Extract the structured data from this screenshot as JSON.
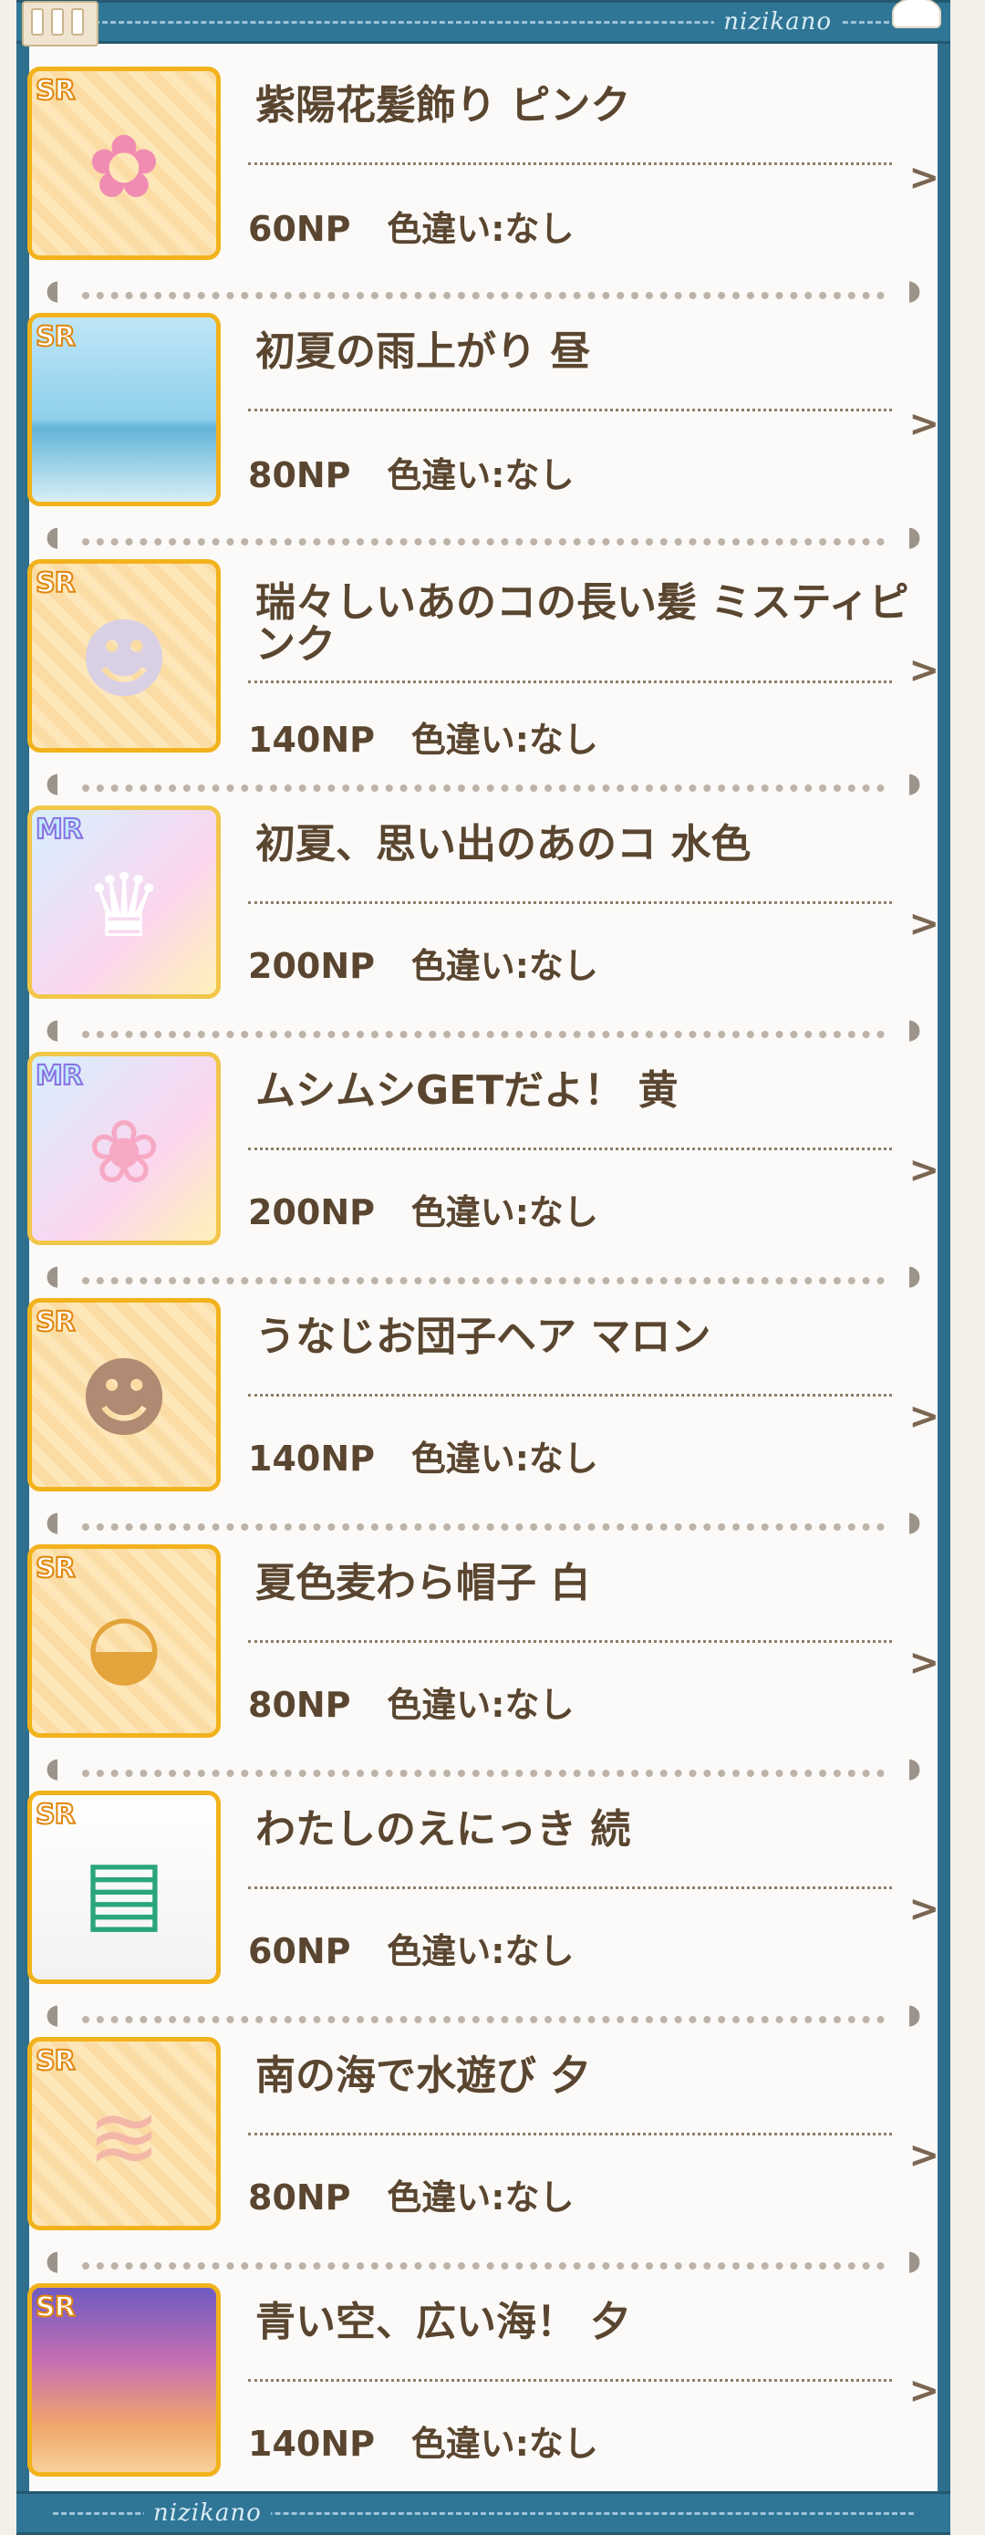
{
  "header": {
    "brand": "nizikano"
  },
  "footer": {
    "brand": "nizikano"
  },
  "items": [
    {
      "rarity": "SR",
      "name": "紫陽花髪飾り ピンク",
      "price": "60NP",
      "variant": "色違い:なし",
      "icon": "hydrangea-hair-ornament-icon"
    },
    {
      "rarity": "SR",
      "name": "初夏の雨上がり 昼",
      "price": "80NP",
      "variant": "色違い:なし",
      "icon": "sky-background-icon"
    },
    {
      "rarity": "SR",
      "name": "瑞々しいあのコの長い髪 ミスティピンク",
      "price": "140NP",
      "variant": "色違い:なし",
      "icon": "long-hair-icon"
    },
    {
      "rarity": "MR",
      "name": "初夏、思い出のあのコ 水色",
      "price": "200NP",
      "variant": "色違い:なし",
      "icon": "summer-dress-icon"
    },
    {
      "rarity": "MR",
      "name": "ムシムシGETだよ！ 黄",
      "price": "200NP",
      "variant": "色違い:なし",
      "icon": "bug-catcher-outfit-icon"
    },
    {
      "rarity": "SR",
      "name": "うなじお団子ヘア マロン",
      "price": "140NP",
      "variant": "色違い:なし",
      "icon": "bun-hair-icon"
    },
    {
      "rarity": "SR",
      "name": "夏色麦わら帽子 白",
      "price": "80NP",
      "variant": "色違い:なし",
      "icon": "straw-hat-icon"
    },
    {
      "rarity": "SR",
      "name": "わたしのえにっき 続",
      "price": "60NP",
      "variant": "色違い:なし",
      "icon": "picture-diary-icon"
    },
    {
      "rarity": "SR",
      "name": "南の海で水遊び 夕",
      "price": "80NP",
      "variant": "色違い:なし",
      "icon": "water-splash-icon"
    },
    {
      "rarity": "SR",
      "name": "青い空、広い海！ 夕",
      "price": "140NP",
      "variant": "色違い:なし",
      "icon": "sunset-sky-background-icon"
    }
  ]
}
